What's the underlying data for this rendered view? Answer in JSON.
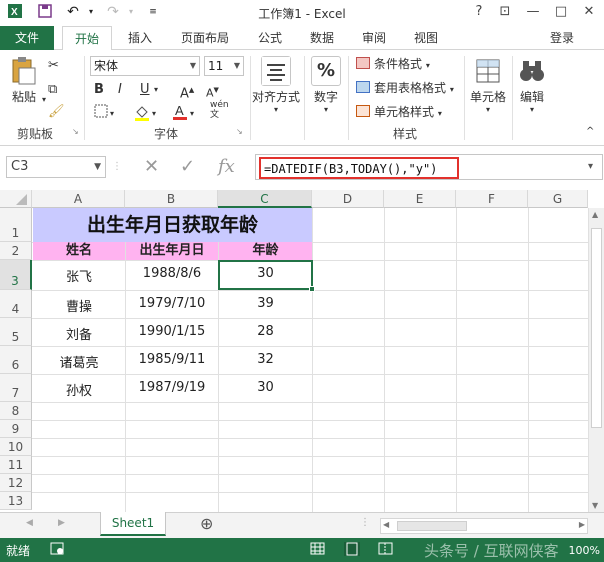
{
  "window": {
    "title": "工作簿1 - Excel",
    "buttons": {
      "help": "?",
      "restore_ribbon": "⊡",
      "minimize": "—",
      "maximize": "□",
      "close": "✕"
    }
  },
  "tabs": [
    "文件",
    "开始",
    "插入",
    "页面布局",
    "公式",
    "数据",
    "审阅",
    "视图"
  ],
  "active_tab": "开始",
  "login": "登录",
  "ribbon": {
    "clipboard": {
      "paste": "粘贴",
      "label": "剪贴板"
    },
    "font": {
      "name": "宋体",
      "size": "11",
      "bold": "B",
      "italic": "I",
      "underline": "U",
      "grow": "A",
      "shrink": "A",
      "wen": "wén",
      "label": "字体"
    },
    "alignment": {
      "label": "对齐方式"
    },
    "number": {
      "label": "数字",
      "icon": "%"
    },
    "styles": {
      "cond": "条件格式",
      "table": "套用表格格式",
      "cell": "单元格样式",
      "label": "样式"
    },
    "cells": {
      "label": "单元格"
    },
    "editing": {
      "label": "编辑"
    }
  },
  "formula_bar": {
    "name_box": "C3",
    "cancel": "✕",
    "enter": "✓",
    "fx": "fx",
    "formula": "=DATEDIF(B3,TODAY(),\"y\")"
  },
  "columns": [
    "A",
    "B",
    "C",
    "D",
    "E",
    "F",
    "G"
  ],
  "rows": [
    "1",
    "2",
    "3",
    "4",
    "5",
    "6",
    "7",
    "8",
    "9",
    "10",
    "11",
    "12",
    "13"
  ],
  "sheet": {
    "title": "出生年月日获取年龄",
    "headers": [
      "姓名",
      "出生年月日",
      "年龄"
    ],
    "data": [
      [
        "张飞",
        "1988/8/6",
        "30"
      ],
      [
        "曹操",
        "1979/7/10",
        "39"
      ],
      [
        "刘备",
        "1990/1/15",
        "28"
      ],
      [
        "诸葛亮",
        "1985/9/11",
        "32"
      ],
      [
        "孙权",
        "1987/9/19",
        "30"
      ]
    ]
  },
  "sheet_tabs": {
    "name": "Sheet1",
    "add": "⊕"
  },
  "status": {
    "ready": "就绪",
    "zoom": "100%",
    "watermark": "头条号 / 互联网侠客"
  },
  "colors": {
    "excel_green": "#217346",
    "title_fill": "#c9caff",
    "header_fill": "#ffb3f0",
    "highlight_box": "#e2312c"
  }
}
